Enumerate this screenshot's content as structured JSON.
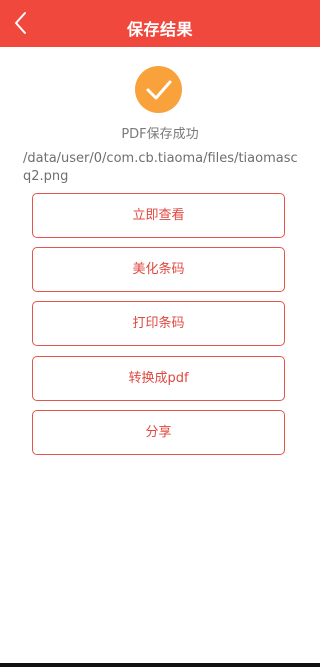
{
  "header": {
    "title": "保存结果",
    "back_icon": "chevron-left-icon",
    "background_color": "#f0483d"
  },
  "result": {
    "icon": "check-circle-icon",
    "icon_color": "#f9a13b",
    "message": "PDF保存成功",
    "file_path": "/data/user/0/com.cb.tiaoma/files/tiaomascq2.png"
  },
  "actions": {
    "view_label": "立即查看",
    "beautify_label": "美化条码",
    "print_label": "打印条码",
    "to_pdf_label": "转换成pdf",
    "share_label": "分享",
    "accent_color": "#e0483f"
  }
}
